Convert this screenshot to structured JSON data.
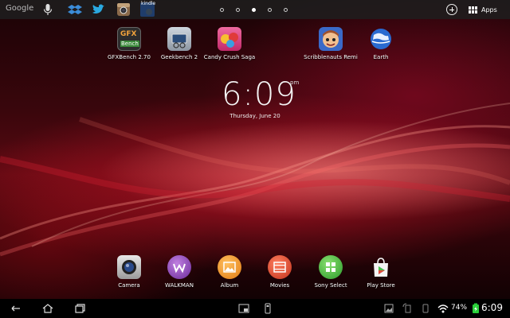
{
  "status_bar": {
    "search_label": "Google",
    "kindle_label": "kindle",
    "apps_label": "Apps",
    "page_count": 5,
    "active_page": 3
  },
  "clock": {
    "time": "6:09",
    "ampm": "pm",
    "date": "Thursday, June 20"
  },
  "home_apps": [
    {
      "label": "GFXBench 2.70",
      "icon": "gfxbench-icon",
      "badge": "GFX",
      "badge2": "Bench"
    },
    {
      "label": "Geekbench 2",
      "icon": "geekbench-icon"
    },
    {
      "label": "Candy Crush Saga",
      "icon": "candy-crush-icon"
    },
    {
      "label": "Scribblenauts Remi",
      "icon": "scribblenauts-icon"
    },
    {
      "label": "Earth",
      "icon": "google-earth-icon"
    }
  ],
  "dock": [
    {
      "label": "Camera",
      "icon": "camera-icon"
    },
    {
      "label": "WALKMAN",
      "icon": "walkman-icon"
    },
    {
      "label": "Album",
      "icon": "album-icon"
    },
    {
      "label": "Movies",
      "icon": "movies-icon"
    },
    {
      "label": "Sony Select",
      "icon": "sony-select-icon"
    },
    {
      "label": "Play Store",
      "icon": "play-store-icon"
    }
  ],
  "system_status": {
    "battery": "74%",
    "time": "6:09"
  },
  "colors": {
    "top_bar_bg": "#1e1e1e",
    "wallpaper_red": "#b0101c",
    "nav_bar_bg": "#000000"
  }
}
